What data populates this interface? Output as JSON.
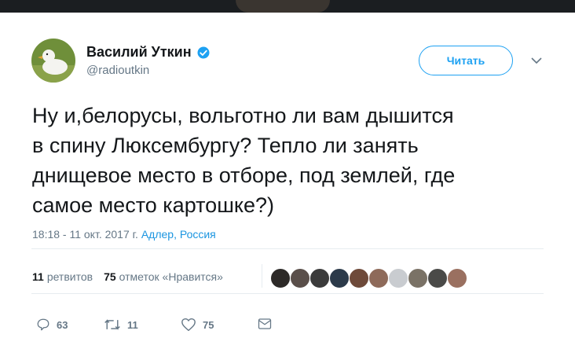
{
  "user": {
    "display_name": "Василий Уткин",
    "handle": "@radioutkin",
    "verified": true,
    "avatar_icon": "duck-avatar-icon"
  },
  "follow_button": {
    "label": "Читать"
  },
  "tweet": {
    "lines": [
      "Ну и,белорусы, вольготно ли вам дышится",
      "в спину Люксембургу? Тепло ли занять",
      "днищевое место в отборе, под землей, где",
      "самое место картошке?)"
    ],
    "time": "18:18 - 11 окт. 2017 г.",
    "location": "Адлер, Россия"
  },
  "stats": {
    "retweets_count": "11",
    "retweets_label": "ретвитов",
    "likes_count": "75",
    "likes_label": "отметок «Нравится»",
    "liker_avatars": 10
  },
  "actions": {
    "reply_count": "63",
    "retweet_count": "11",
    "like_count": "75"
  },
  "colors": {
    "accent": "#1da1f2",
    "muted": "#657786",
    "text": "#14171a",
    "link": "#1b95e0"
  }
}
